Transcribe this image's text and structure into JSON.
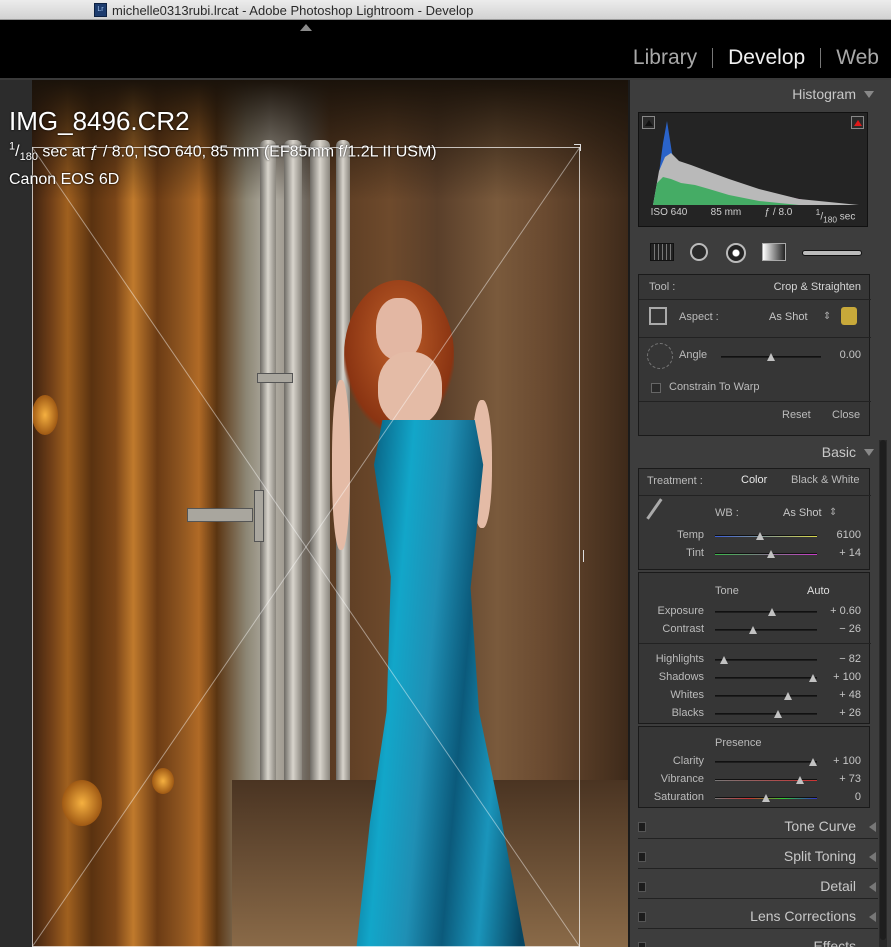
{
  "window": {
    "title": "michelle0313rubi.lrcat - Adobe Photoshop Lightroom - Develop",
    "doc_icon": "Lr"
  },
  "modules": [
    {
      "label": "Library",
      "active": false
    },
    {
      "label": "Develop",
      "active": true
    },
    {
      "label": "Web",
      "active": false
    }
  ],
  "photo_info": {
    "filename": "IMG_8496.CR2",
    "shutter_num": "1",
    "shutter_den": "180",
    "exposure_rest": " sec at ƒ / 8.0, ISO 640, 85 mm (EF85mm f/1.2L II USM)",
    "camera": "Canon EOS 6D"
  },
  "histogram": {
    "title": "Histogram",
    "iso": "ISO 640",
    "focal": "85 mm",
    "aperture": "ƒ / 8.0",
    "shutter_num": "1",
    "shutter_den": "180",
    "shutter_unit": "sec"
  },
  "tools": [
    "crop-overlay-icon",
    "spot-removal-icon",
    "red-eye-icon",
    "graduated-filter-icon",
    "adjustment-brush-icon"
  ],
  "crop_panel": {
    "tool_label": "Tool :",
    "tool_value": "Crop & Straighten",
    "aspect_label": "Aspect :",
    "aspect_value": "As Shot",
    "angle_label": "Angle",
    "angle_value": "0.00",
    "angle_level": 0.5,
    "constrain_label": "Constrain To Warp",
    "reset_label": "Reset",
    "close_label": "Close"
  },
  "basic": {
    "title": "Basic",
    "treatment_label": "Treatment :",
    "treatment_color": "Color",
    "treatment_bw": "Black & White",
    "wb_label": "WB :",
    "wb_value": "As Shot",
    "temp": {
      "label": "Temp",
      "value": "6100",
      "level": 0.44
    },
    "tint": {
      "label": "Tint",
      "value": "+ 14",
      "level": 0.55
    },
    "tone_label": "Tone",
    "auto_label": "Auto",
    "exposure": {
      "label": "Exposure",
      "value": "+ 0.60",
      "level": 0.56
    },
    "contrast": {
      "label": "Contrast",
      "value": "− 26",
      "level": 0.37
    },
    "highlights": {
      "label": "Highlights",
      "value": "− 82",
      "level": 0.09
    },
    "shadows": {
      "label": "Shadows",
      "value": "+ 100",
      "level": 0.96
    },
    "whites": {
      "label": "Whites",
      "value": "+ 48",
      "level": 0.72
    },
    "blacks": {
      "label": "Blacks",
      "value": "+ 26",
      "level": 0.62
    },
    "presence_label": "Presence",
    "clarity": {
      "label": "Clarity",
      "value": "+ 100",
      "level": 0.96
    },
    "vibrance": {
      "label": "Vibrance",
      "value": "+ 73",
      "level": 0.83
    },
    "saturation": {
      "label": "Saturation",
      "value": "0",
      "level": 0.5
    }
  },
  "panels": [
    "Tone Curve",
    "Split Toning",
    "Detail",
    "Lens Corrections",
    "Effects"
  ],
  "colors": {
    "accent_active": "#f0f0f0",
    "clip_highlight": "#e01818"
  }
}
